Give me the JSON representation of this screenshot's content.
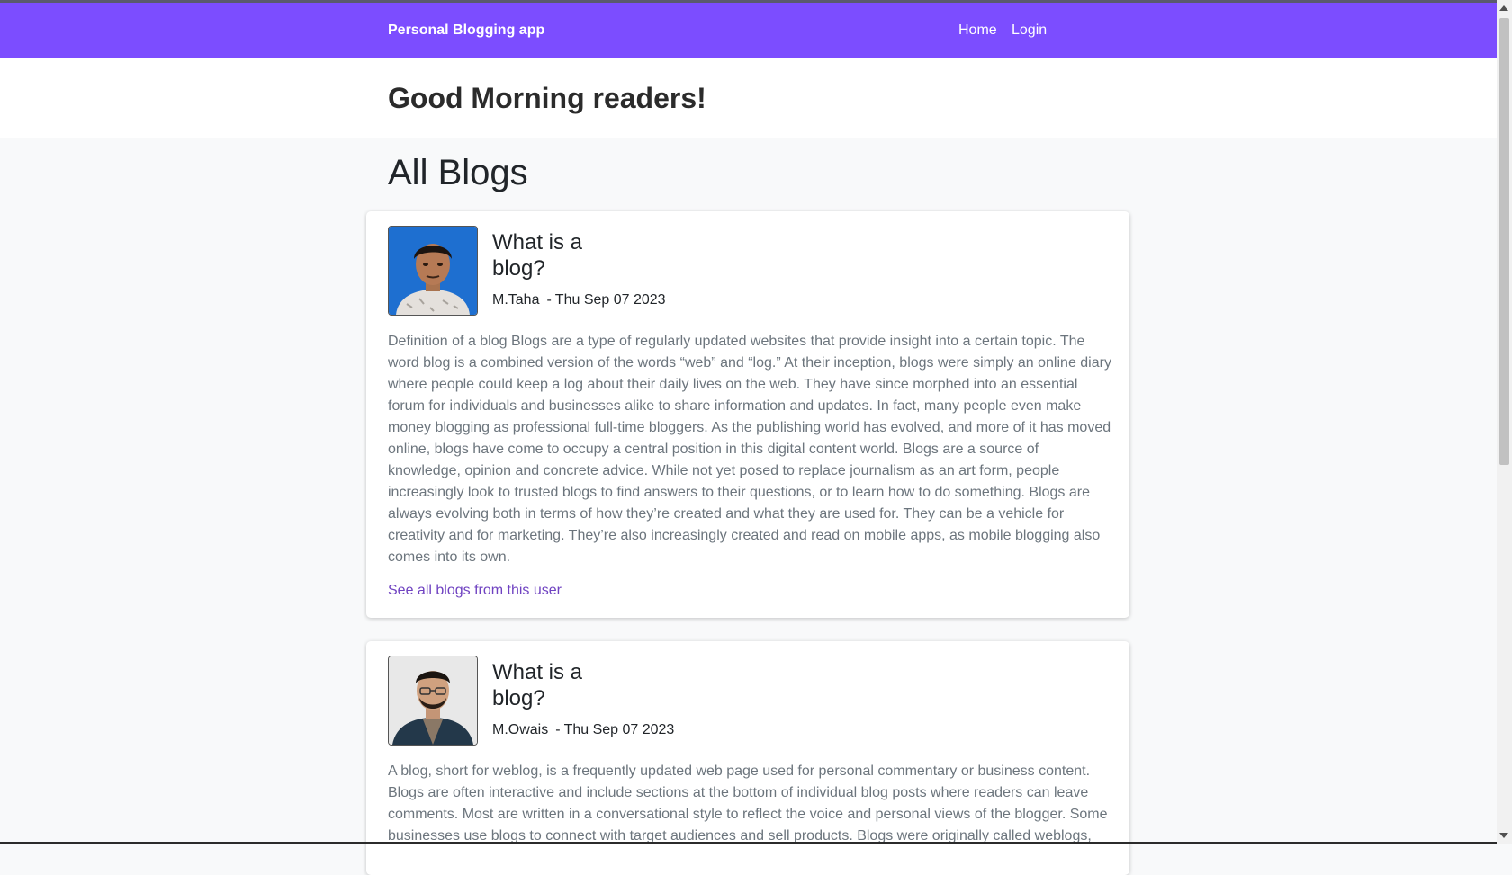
{
  "navbar": {
    "brand": "Personal Blogging app",
    "links": [
      "Home",
      "Login"
    ],
    "color": "#7c4dff"
  },
  "greeting": "Good Morning readers!",
  "page_title": "All Blogs",
  "link_color": "#6f42c1",
  "posts": [
    {
      "title": "What is a blog?",
      "author": "M.Taha",
      "separator": "-",
      "date": "Thu Sep 07 2023",
      "body": "Definition of a blog Blogs are a type of regularly updated websites that provide insight into a certain topic. The word blog is a combined version of the words “web” and “log.” At their inception, blogs were simply an online diary where people could keep a log about their daily lives on the web. They have since morphed into an essential forum for individuals and businesses alike to share information and updates. In fact, many people even make money blogging as professional full-time bloggers. As the publishing world has evolved, and more of it has moved online, blogs have come to occupy a central position in this digital content world. Blogs are a source of knowledge, opinion and concrete advice. While not yet posed to replace journalism as an art form, people increasingly look to trusted blogs to find answers to their questions, or to learn how to do something. Blogs are always evolving both in terms of how they’re created and what they are used for. They can be a vehicle for creativity and for marketing. They’re also increasingly created and read on mobile apps, as mobile blogging also comes into its own.",
      "link": "See all blogs from this user"
    },
    {
      "title": "What is a blog?",
      "author": "M.Owais",
      "separator": "-",
      "date": "Thu Sep 07 2023",
      "body": "A blog, short for weblog, is a frequently updated web page used for personal commentary or business content. Blogs are often interactive and include sections at the bottom of individual blog posts where readers can leave comments. Most are written in a conversational style to reflect the voice and personal views of the blogger. Some businesses use blogs to connect with target audiences and sell products. Blogs were originally called weblogs,"
    }
  ]
}
